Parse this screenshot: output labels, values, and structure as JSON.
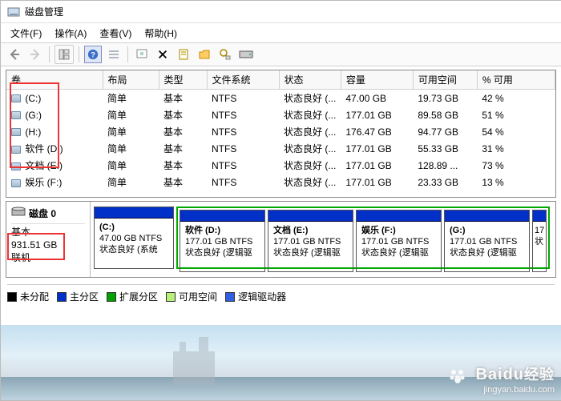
{
  "window": {
    "title": "磁盘管理"
  },
  "menubar": {
    "items": [
      "文件(F)",
      "操作(A)",
      "查看(V)",
      "帮助(H)"
    ]
  },
  "table": {
    "columns": [
      "卷",
      "布局",
      "类型",
      "文件系统",
      "状态",
      "容量",
      "可用空间",
      "% 可用"
    ],
    "rows": [
      {
        "vol": "(C:)",
        "layout": "简单",
        "type": "基本",
        "fs": "NTFS",
        "status": "状态良好 (...",
        "capacity": "47.00 GB",
        "free": "19.73 GB",
        "pct": "42 %"
      },
      {
        "vol": "(G:)",
        "layout": "简单",
        "type": "基本",
        "fs": "NTFS",
        "status": "状态良好 (...",
        "capacity": "177.01 GB",
        "free": "89.58 GB",
        "pct": "51 %"
      },
      {
        "vol": "(H:)",
        "layout": "简单",
        "type": "基本",
        "fs": "NTFS",
        "status": "状态良好 (...",
        "capacity": "176.47 GB",
        "free": "94.77 GB",
        "pct": "54 %"
      },
      {
        "vol": "软件 (D:)",
        "layout": "简单",
        "type": "基本",
        "fs": "NTFS",
        "status": "状态良好 (...",
        "capacity": "177.01 GB",
        "free": "55.33 GB",
        "pct": "31 %"
      },
      {
        "vol": "文档 (E:)",
        "layout": "简单",
        "type": "基本",
        "fs": "NTFS",
        "status": "状态良好 (...",
        "capacity": "177.01 GB",
        "free": "128.89 ...",
        "pct": "73 %"
      },
      {
        "vol": "娱乐 (F:)",
        "layout": "简单",
        "type": "基本",
        "fs": "NTFS",
        "status": "状态良好 (...",
        "capacity": "177.01 GB",
        "free": "23.33 GB",
        "pct": "13 %"
      }
    ]
  },
  "disk": {
    "label": "磁盘 0",
    "type": "基本",
    "size": "931.51 GB",
    "status": "联机",
    "partitions": [
      {
        "title": "(C:)",
        "line2": "47.00 GB NTFS",
        "line3": "状态良好 (系统"
      },
      {
        "title": "软件 (D:)",
        "line2": "177.01 GB NTFS",
        "line3": "状态良好 (逻辑驱"
      },
      {
        "title": "文档 (E:)",
        "line2": "177.01 GB NTFS",
        "line3": "状态良好 (逻辑驱"
      },
      {
        "title": "娱乐 (F:)",
        "line2": "177.01 GB NTFS",
        "line3": "状态良好 (逻辑驱"
      },
      {
        "title": "(G:)",
        "line2": "177.01 GB NTFS",
        "line3": "状态良好 (逻辑驱"
      },
      {
        "title": "",
        "line2": "17",
        "line3": "状"
      }
    ]
  },
  "legend": {
    "items": [
      {
        "label": "未分配",
        "color": "#000000"
      },
      {
        "label": "主分区",
        "color": "#0030c8"
      },
      {
        "label": "扩展分区",
        "color": "#00a000"
      },
      {
        "label": "可用空间",
        "color": "#b8f078"
      },
      {
        "label": "逻辑驱动器",
        "color": "#3060e0"
      }
    ]
  },
  "watermark": {
    "logo": "Bai",
    "logo2": "du",
    "logo3": "经验",
    "url": "jingyan.baidu.com"
  }
}
